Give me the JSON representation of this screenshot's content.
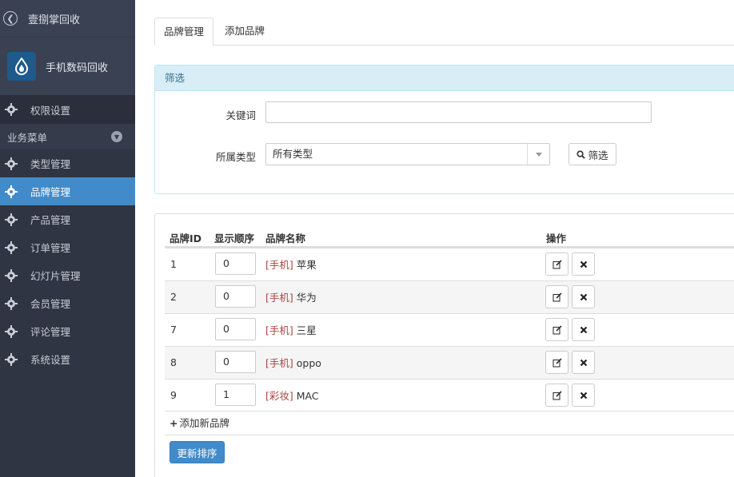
{
  "sidebar": {
    "back_title": "壹捌掌回收",
    "brand_name": "手机数码回收",
    "permission_label": "权限设置",
    "section_label": "业务菜单",
    "items": [
      {
        "label": "类型管理",
        "active": false
      },
      {
        "label": "品牌管理",
        "active": true
      },
      {
        "label": "产品管理",
        "active": false
      },
      {
        "label": "订单管理",
        "active": false
      },
      {
        "label": "幻灯片管理",
        "active": false
      },
      {
        "label": "会员管理",
        "active": false
      },
      {
        "label": "评论管理",
        "active": false
      },
      {
        "label": "系统设置",
        "active": false
      }
    ]
  },
  "tabs": {
    "brand_manage": "品牌管理",
    "add_brand": "添加品牌"
  },
  "filter": {
    "title": "筛选",
    "keyword_label": "关键词",
    "keyword_value": "",
    "type_label": "所属类型",
    "type_value": "所有类型",
    "button": "筛选"
  },
  "table": {
    "headers": {
      "id": "品牌ID",
      "order": "显示顺序",
      "name": "品牌名称",
      "action": "操作"
    },
    "rows": [
      {
        "id": "1",
        "order": "0",
        "category": "[手机]",
        "name": "苹果"
      },
      {
        "id": "2",
        "order": "0",
        "category": "[手机]",
        "name": "华为"
      },
      {
        "id": "7",
        "order": "0",
        "category": "[手机]",
        "name": "三星"
      },
      {
        "id": "8",
        "order": "0",
        "category": "[手机]",
        "name": "oppo"
      },
      {
        "id": "9",
        "order": "1",
        "category": "[彩妆]",
        "name": "MAC"
      }
    ],
    "add_label": "添加新品牌",
    "update_button": "更新排序"
  },
  "colors": {
    "sidebar_bg": "#2f3542",
    "active_bg": "#428bca",
    "category_text": "#a94442",
    "filter_header_bg": "#d9edf7"
  }
}
